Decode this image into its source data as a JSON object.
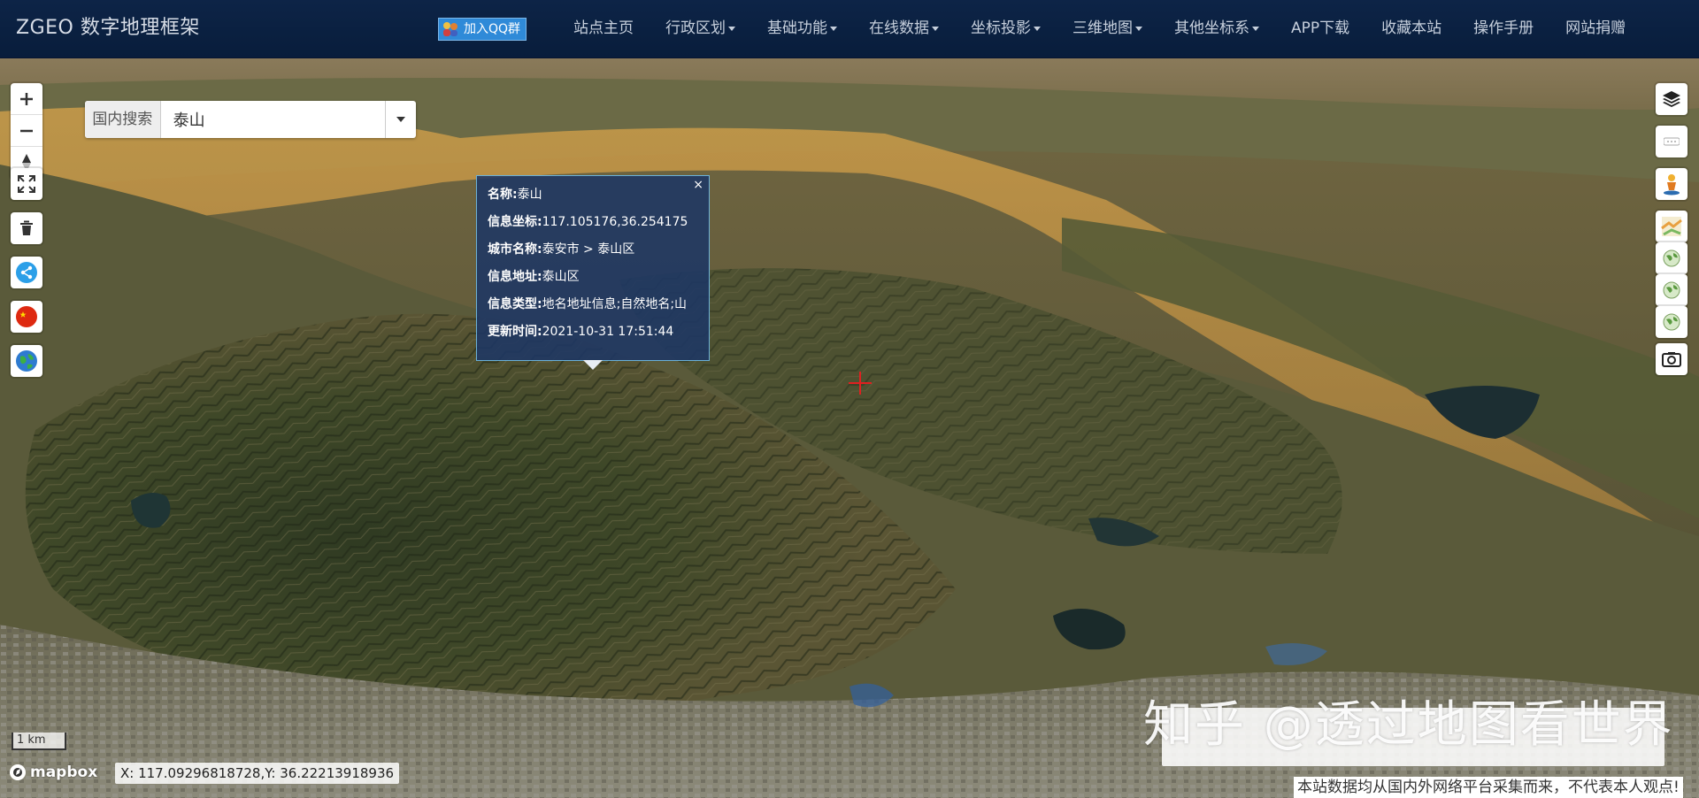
{
  "navbar": {
    "brand": "ZGEO 数字地理框架",
    "qq_button": "加入QQ群",
    "menu": [
      {
        "label": "站点主页",
        "dropdown": false
      },
      {
        "label": "行政区划",
        "dropdown": true
      },
      {
        "label": "基础功能",
        "dropdown": true
      },
      {
        "label": "在线数据",
        "dropdown": true
      },
      {
        "label": "坐标投影",
        "dropdown": true
      },
      {
        "label": "三维地图",
        "dropdown": true
      },
      {
        "label": "其他坐标系",
        "dropdown": true
      },
      {
        "label": "APP下载",
        "dropdown": false
      },
      {
        "label": "收藏本站",
        "dropdown": false
      },
      {
        "label": "操作手册",
        "dropdown": false
      },
      {
        "label": "网站捐赠",
        "dropdown": false
      }
    ]
  },
  "search": {
    "scope_label": "国内搜索",
    "value": "泰山"
  },
  "popup": {
    "close": "×",
    "rows": [
      {
        "key": "名称:",
        "value": "泰山"
      },
      {
        "key": "信息坐标:",
        "value": "117.105176,36.254175"
      },
      {
        "key": "城市名称:",
        "value": "泰安市 > 泰山区"
      },
      {
        "key": "信息地址:",
        "value": "泰山区"
      },
      {
        "key": "信息类型:",
        "value": "地名地址信息;自然地名;山"
      },
      {
        "key": "更新时间:",
        "value": "2021-10-31 17:51:44"
      }
    ]
  },
  "map": {
    "scale_label": "1 km",
    "attribution_logo": "mapbox",
    "coords_readout": "X:  117.09296818728,Y:  36.22213918936"
  },
  "overlay": {
    "watermark": "知乎 @透过地图看世界",
    "disclaimer": "本站数据均从国内外网络平台采集而来，不代表本人观点!"
  },
  "colors": {
    "navbar_bg": "#0a1f40",
    "popup_bg": "#1e3764",
    "popup_border": "#6ab0d8",
    "qq_button": "#2f8ad8",
    "crosshair": "#e02020"
  },
  "icons": {
    "left_controls": [
      "zoom-in-icon",
      "zoom-out-icon",
      "compass-icon",
      "fullscreen-icon",
      "trash-icon",
      "share-icon",
      "china-flag-icon",
      "globe-icon"
    ],
    "right_controls": [
      "layers-icon",
      "ellipsis-icon",
      "person-marker-icon",
      "map-thumbnail-icon",
      "globe-layer-icon",
      "screenshot-icon"
    ]
  }
}
